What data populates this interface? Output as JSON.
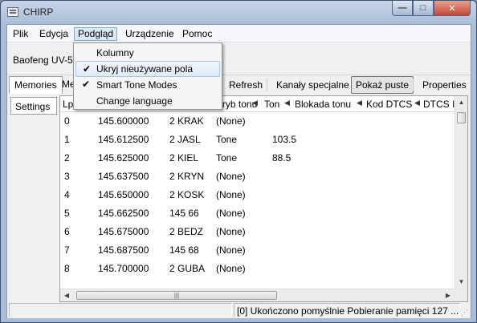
{
  "window": {
    "title": "CHIRP"
  },
  "menubar": {
    "items": [
      "Plik",
      "Edycja",
      "Podgląd",
      "Urządzenie",
      "Pomoc"
    ]
  },
  "radio_name": "Baofeng UV-5R",
  "tabs": {
    "memories": "Memories",
    "me_partial": "Me"
  },
  "toolbar": {
    "refresh": "Refresh",
    "special_channels": "Kanały specjalne",
    "show_empty": "Pokaż puste",
    "properties": "Properties"
  },
  "subtabs": {
    "settings": "Settings"
  },
  "grid": {
    "headers": {
      "loc": "Lp",
      "tone_mode": "Tryb tonu",
      "tone": "Ton",
      "tone_squelch": "Blokada tonu",
      "dtcs_code": "Kod DTCS",
      "dtcs_partial": "DTCS I"
    },
    "rows": [
      {
        "loc": "0",
        "freq": "145.600000",
        "name": "2 KRAK",
        "tone_mode": "(None)",
        "tone": ""
      },
      {
        "loc": "1",
        "freq": "145.612500",
        "name": "2 JASL",
        "tone_mode": "Tone",
        "tone": "103.5"
      },
      {
        "loc": "2",
        "freq": "145.625000",
        "name": "2 KIEL",
        "tone_mode": "Tone",
        "tone": "88.5"
      },
      {
        "loc": "3",
        "freq": "145.637500",
        "name": "2 KRYN",
        "tone_mode": "(None)",
        "tone": ""
      },
      {
        "loc": "4",
        "freq": "145.650000",
        "name": "2 KOSK",
        "tone_mode": "(None)",
        "tone": ""
      },
      {
        "loc": "5",
        "freq": "145.662500",
        "name": "145 66",
        "tone_mode": "(None)",
        "tone": ""
      },
      {
        "loc": "6",
        "freq": "145.675000",
        "name": "2 BEDZ",
        "tone_mode": "(None)",
        "tone": ""
      },
      {
        "loc": "7",
        "freq": "145.687500",
        "name": "145 68",
        "tone_mode": "(None)",
        "tone": ""
      },
      {
        "loc": "8",
        "freq": "145.700000",
        "name": "2 GUBA",
        "tone_mode": "(None)",
        "tone": ""
      }
    ]
  },
  "dropdown": {
    "items": [
      {
        "label": "Kolumny",
        "checked": false
      },
      {
        "label": "Ukryj nieużywane pola",
        "checked": true
      },
      {
        "label": "Smart Tone Modes",
        "checked": true
      },
      {
        "label": "Change language",
        "checked": false
      }
    ]
  },
  "status": {
    "message": "[0] Ukończono pomyślnie Pobieranie pamięci 127 ..."
  },
  "icons": {
    "check": "✔",
    "sort_arrow": "◀",
    "close": "✕",
    "minimize": "—",
    "maximize": "□"
  }
}
